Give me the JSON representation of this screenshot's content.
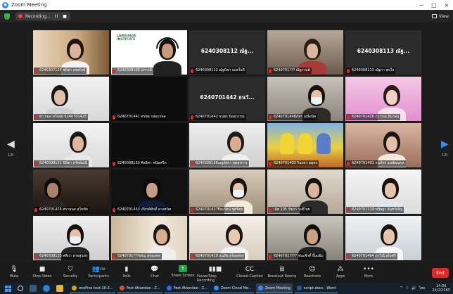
{
  "window": {
    "title": "Zoom Meeting"
  },
  "top_bar": {
    "recording_label": "Recording...",
    "pause_glyph": "II",
    "stop_glyph": "■",
    "view_label": "View"
  },
  "participants_grid": [
    {
      "label": "6240307124 ชนิตา เทพรักษ์",
      "tile_style": "room-window"
    },
    {
      "label": "6240308109 ปภาวดี",
      "tile_style": "teacher-logo",
      "active": true
    },
    {
      "label": "6240308112 ณัฐนิชา ยอดใจดี",
      "big_name": "6240308112 ณัฐ...",
      "tile_style": "name-only"
    },
    {
      "label": "6240701??? ณัฐกานต์",
      "tile_style": "room-hat"
    },
    {
      "label": "6240308113 ณัฐภา สุขใจ",
      "big_name": "6240308113 ณัฐ...",
      "tile_style": "name-only"
    },
    {
      "label": "ศา กมล ทวีปลัย 6240701425",
      "tile_style": "room-white"
    },
    {
      "label": "6240701441 พรพล กล่อมรอด",
      "tile_style": "dark"
    },
    {
      "label": "6240701442 ธนพร นิลสุวรรณ",
      "big_name": "6240701442 ธนวั...",
      "tile_style": "name-only"
    },
    {
      "label": "6240701448ภัทร มณีดนัย",
      "tile_style": "mask-girl"
    },
    {
      "label": "6240701426 ภาวรณ มินาคม",
      "tile_style": "pink"
    },
    {
      "label": "6240008121 นิษิตา ทรัพย์มณี",
      "tile_style": "girl-white"
    },
    {
      "label": "6240008130 ศิลลิศา ชนิษศรีท",
      "tile_style": "dark"
    },
    {
      "label": "6240308126ณฐภัศรา ทุศสุรการ",
      "tile_style": "girl-light"
    },
    {
      "label": "6240701403 รินรดา สมุทร",
      "tile_style": "simpsons"
    },
    {
      "label": "6240701401 กนภัทร ธนพัฒนกุล",
      "tile_style": "girl-curtain"
    },
    {
      "label": "6240701474 ศรามนส สุโขทัย",
      "tile_style": "car"
    },
    {
      "label": "6240701453 เกียรติศักดิ์ ดวงสนิท",
      "tile_style": "boy-dark"
    },
    {
      "label": "6240701427ปิยะรัตน์ ชูศรีสุข",
      "tile_style": "mask-room"
    },
    {
      "label": "เลิศ 105 รัชภา วงศ์ไทย",
      "tile_style": "girl-room"
    },
    {
      "label": "6240701119 ขนิษฐา จันทร์เพ็ญ",
      "tile_style": "girl-bright"
    },
    {
      "label": "6240308133 ศศิภา สายสุนทร",
      "tile_style": "mask-girl2"
    },
    {
      "label": "6240701???ชรัญ สุขมงคล",
      "tile_style": "room-shelf"
    },
    {
      "label": "6240701419 ธนภัท สร้อยทอง",
      "tile_style": "girl-bright2"
    },
    {
      "label": "6240701???? ชนะศักดิ์ ยิ้มแย้ม",
      "tile_style": "boy-room"
    },
    {
      "label": "6240701464 ภาวิณี เต็มศรี",
      "tile_style": "girl-white2"
    }
  ],
  "pagination": {
    "left": "1/8",
    "right": "1/8"
  },
  "toolbar": {
    "mute": "Mute",
    "stop_video": "Stop Video",
    "security": "Security",
    "participants": "Participants",
    "participants_count": "150",
    "polls": "Polls",
    "chat": "Chat",
    "share_screen": "Share Screen",
    "pause_stop_recording": "Pause/Stop Recording",
    "closed_caption": "Closed Caption",
    "breakout_rooms": "Breakout Rooms",
    "reactions": "Reactions",
    "apps": "Apps",
    "more": "More",
    "end": "End"
  },
  "taskbar": {
    "apps": [
      {
        "label": "oneFive-test-10-2...",
        "color": "#d9a21b"
      },
      {
        "label": "Post Attendee - Z...",
        "color": "#e34a2f"
      },
      {
        "label": "Post Attendee - Z...",
        "color": "#2f6ae3"
      },
      {
        "label": "Zoom Cloud Me...",
        "color": "#2d8cff"
      },
      {
        "label": "Zoom Meeting",
        "color": "#2d8cff",
        "active": true
      },
      {
        "label": "script.docx - Word",
        "color": "#2b579a"
      }
    ],
    "language": "ไทย",
    "time": "14:06",
    "date": "24/2/2565"
  },
  "colors": {
    "accent": "#2d8cff",
    "share": "#1fa645",
    "end": "#e02828",
    "active_speaker": "#5bc236"
  }
}
